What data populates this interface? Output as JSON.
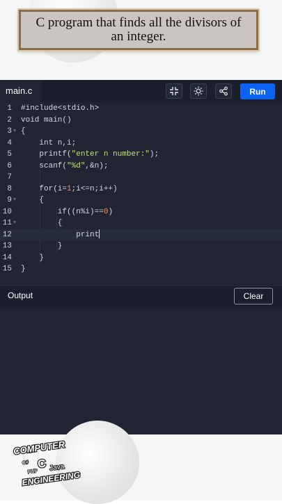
{
  "banner": {
    "title": "C program that finds all the divisors of an integer."
  },
  "editor": {
    "tab_label": "main.c",
    "run_label": "Run",
    "colors": {
      "run": "#0b63f3",
      "background": "#202433",
      "string": "#c5e478",
      "number": "#f78c6c"
    },
    "code_lines": [
      {
        "n": "1",
        "fold": "",
        "parts": [
          [
            "#include<stdio.h>",
            "#d7dae0"
          ]
        ]
      },
      {
        "n": "2",
        "fold": "",
        "parts": [
          [
            "void main()",
            "#d7dae0"
          ]
        ]
      },
      {
        "n": "3",
        "fold": "▾",
        "parts": [
          [
            "{",
            "#d7dae0"
          ]
        ]
      },
      {
        "n": "4",
        "fold": "",
        "parts": [
          [
            "    int n,i;",
            "#d7dae0"
          ]
        ]
      },
      {
        "n": "5",
        "fold": "",
        "parts": [
          [
            "    printf(",
            "#d7dae0"
          ],
          [
            "\"enter n number:\"",
            "#c5e478"
          ],
          [
            ");",
            "#d7dae0"
          ]
        ]
      },
      {
        "n": "6",
        "fold": "",
        "parts": [
          [
            "    scanf(",
            "#d7dae0"
          ],
          [
            "\"%d\"",
            "#c5e478"
          ],
          [
            ",&n);",
            "#d7dae0"
          ]
        ]
      },
      {
        "n": "7",
        "fold": "",
        "parts": [
          [
            "",
            "#d7dae0"
          ]
        ]
      },
      {
        "n": "8",
        "fold": "",
        "parts": [
          [
            "    for(i=",
            "#d7dae0"
          ],
          [
            "1",
            "#f78c6c"
          ],
          [
            ";i<=n;i++)",
            "#d7dae0"
          ]
        ]
      },
      {
        "n": "9",
        "fold": "▾",
        "parts": [
          [
            "    {",
            "#d7dae0"
          ]
        ]
      },
      {
        "n": "10",
        "fold": "",
        "parts": [
          [
            "        if((n%i)==",
            "#d7dae0"
          ],
          [
            "0",
            "#f78c6c"
          ],
          [
            ")",
            "#d7dae0"
          ]
        ]
      },
      {
        "n": "11",
        "fold": "▾",
        "parts": [
          [
            "        {",
            "#d7dae0"
          ]
        ]
      },
      {
        "n": "12",
        "fold": "",
        "parts": [
          [
            "            print",
            "#d7dae0"
          ]
        ],
        "active": true,
        "cursor": true
      },
      {
        "n": "13",
        "fold": "",
        "parts": [
          [
            "        }",
            "#d7dae0"
          ]
        ]
      },
      {
        "n": "14",
        "fold": "",
        "parts": [
          [
            "    }",
            "#d7dae0"
          ]
        ]
      },
      {
        "n": "15",
        "fold": "",
        "parts": [
          [
            "}",
            "#d7dae0"
          ]
        ]
      }
    ],
    "output_label": "Output",
    "clear_label": "Clear",
    "output_text": ""
  },
  "toolbar_icons": [
    "collapse-icon",
    "brightness-icon",
    "share-icon"
  ],
  "logo": {
    "top": "COMPUTER",
    "bottom": "ENGINEERING",
    "tags": [
      "C",
      "Java",
      "C#",
      "PHP"
    ]
  }
}
